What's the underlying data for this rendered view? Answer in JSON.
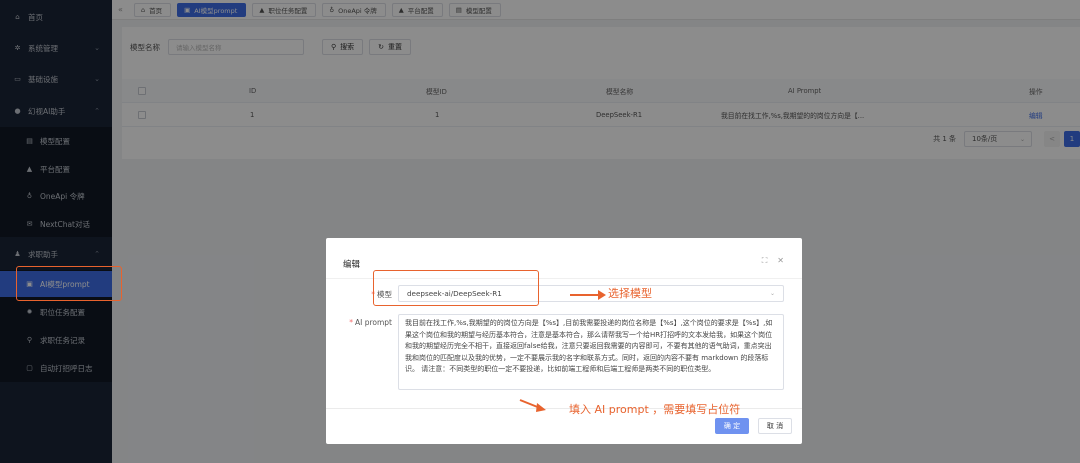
{
  "sidebar": {
    "items": [
      {
        "label": "首页",
        "icon": "home-icon"
      },
      {
        "label": "系统管理",
        "icon": "gear-icon"
      },
      {
        "label": "基础设施",
        "icon": "monitor-icon"
      },
      {
        "label": "幻视AI助手",
        "icon": "apple-icon"
      },
      {
        "label": "模型配置",
        "icon": "model-icon"
      },
      {
        "label": "平台配置",
        "icon": "bag-icon"
      },
      {
        "label": "OneApi 令牌",
        "icon": "key-icon"
      },
      {
        "label": "NextChat对话",
        "icon": "mail-icon"
      },
      {
        "label": "求职助手",
        "icon": "users-icon"
      },
      {
        "label": "AI模型prompt",
        "icon": "document-icon"
      },
      {
        "label": "职位任务配置",
        "icon": "sun-icon"
      },
      {
        "label": "求职任务记录",
        "icon": "pin-icon"
      },
      {
        "label": "自动打招呼日志",
        "icon": "log-icon"
      }
    ]
  },
  "tabs": [
    {
      "label": "首页",
      "icon": "home-icon"
    },
    {
      "label": "AI模型prompt",
      "icon": "document-icon",
      "active": true
    },
    {
      "label": "职位任务配置",
      "icon": "lock-icon"
    },
    {
      "label": "OneApi 令牌",
      "icon": "key-icon"
    },
    {
      "label": "平台配置",
      "icon": "bag-icon"
    },
    {
      "label": "模型配置",
      "icon": "model-icon"
    }
  ],
  "search": {
    "label": "模型名称",
    "placeholder": "请输入模型名称",
    "search_btn": "搜索",
    "reset_btn": "重置"
  },
  "table": {
    "columns": [
      "ID",
      "模型ID",
      "模型名称",
      "AI Prompt",
      "操作"
    ],
    "rows": [
      {
        "id": "1",
        "model_id": "1",
        "model_name": "DeepSeek-R1",
        "prompt": "我目前在找工作,%s,我期望的的岗位方向是【...",
        "action": "编辑"
      }
    ]
  },
  "pagination": {
    "total": "共 1 条",
    "page_size": "10条/页",
    "prev": "<",
    "current": "1"
  },
  "modal": {
    "title": "编辑",
    "model_label": "模型",
    "model_value": "deepseek-ai/DeepSeek-R1",
    "prompt_label": "AI prompt",
    "prompt_value": "我目前在找工作,%s,我期望的的岗位方向是【%s】,目前我需要投递的岗位名称是【%s】,这个岗位的要求是【%s】,如果这个岗位和我的期望与经历基本符合，注意是基本符合，那么请帮我写一个给HR打招呼的文本发给我，如果这个岗位和我的期望经历完全不相干，直接返回false给我，注意只要返回我需要的内容即可，不要有其他的语气助词，重点突出我和岗位的匹配度以及我的优势，一定不要展示我的名字和联系方式。同时，返回的内容不要有 markdown 的段落标识。 请注意：不同类型的职位一定不要投递，比如前端工程师和后端工程师是两类不同的职位类型。",
    "ok_btn": "确 定",
    "cancel_btn": "取 消"
  },
  "annotations": {
    "select_model": "选择模型",
    "fill_prompt": "填入 AI prompt ，需要填写占位符",
    "color": "#e8632e"
  }
}
